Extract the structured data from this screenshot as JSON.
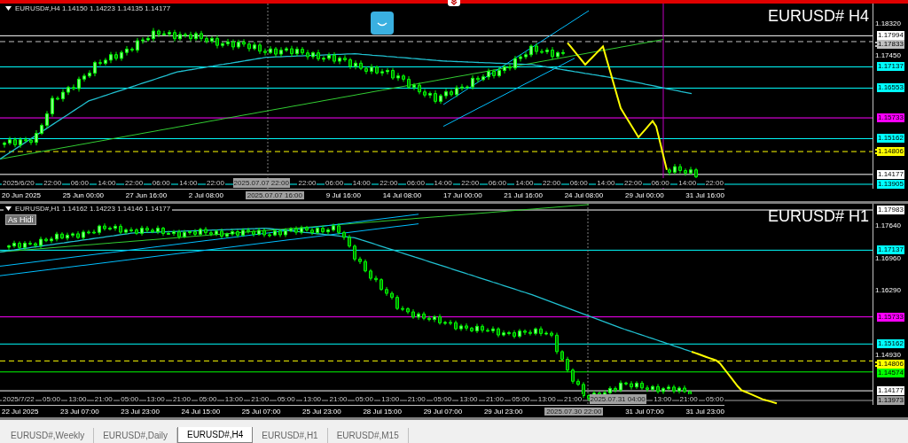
{
  "charts": [
    {
      "header": "EURUSD#,H4  1.14150 1.14223 1.14135 1.14177",
      "title": "EURUSD# H4",
      "price_labels": [
        {
          "text": "1.18320",
          "kind": "tick"
        },
        {
          "text": "1.17994",
          "kind": "marker",
          "color": "#ffffff",
          "dashed": false
        },
        {
          "text": "1.17833",
          "kind": "marker",
          "color": "#c0c0c0",
          "dashed": true
        },
        {
          "text": "1.17450",
          "kind": "tick"
        },
        {
          "text": "1.17137",
          "kind": "marker",
          "color": "#00ffff",
          "dashed": false
        },
        {
          "text": "1.16553",
          "kind": "marker",
          "color": "#00ffff",
          "dashed": false
        },
        {
          "text": "1.15733",
          "kind": "marker",
          "color": "#ff00ff",
          "dashed": false
        },
        {
          "text": "1.15162",
          "kind": "marker",
          "color": "#00ffff",
          "dashed": false
        },
        {
          "text": "1.14806",
          "kind": "marker",
          "color": "#ffff00",
          "dashed": true
        },
        {
          "text": "1.14177",
          "kind": "marker",
          "color": "#ffffff",
          "dashed": false
        },
        {
          "text": "1.13905",
          "kind": "marker",
          "color": "#00ffff",
          "dashed": false
        }
      ],
      "time_upper": [
        {
          "text": "2025/6/20",
          "kind": "time"
        },
        {
          "text": "22:00",
          "kind": "time"
        },
        {
          "text": "06:00",
          "kind": "time"
        },
        {
          "text": "14:00",
          "kind": "time"
        },
        {
          "text": "22:00",
          "kind": "time"
        },
        {
          "text": "06:00",
          "kind": "time"
        },
        {
          "text": "14:00",
          "kind": "time"
        },
        {
          "text": "22:00",
          "kind": "time"
        },
        {
          "text": "2025.07.07 22:00",
          "kind": "crosshair"
        },
        {
          "text": "22:00",
          "kind": "time"
        },
        {
          "text": "06:00",
          "kind": "time"
        },
        {
          "text": "14:00",
          "kind": "time"
        },
        {
          "text": "22:00",
          "kind": "time"
        },
        {
          "text": "06:00",
          "kind": "time"
        },
        {
          "text": "14:00",
          "kind": "time"
        },
        {
          "text": "22:00",
          "kind": "time"
        },
        {
          "text": "06:00",
          "kind": "time"
        },
        {
          "text": "14:00",
          "kind": "time"
        },
        {
          "text": "22:00",
          "kind": "time"
        },
        {
          "text": "06:00",
          "kind": "time"
        },
        {
          "text": "14:00",
          "kind": "time"
        },
        {
          "text": "22:00",
          "kind": "time"
        },
        {
          "text": "06:00",
          "kind": "time"
        },
        {
          "text": "14:00",
          "kind": "time"
        },
        {
          "text": "22:00",
          "kind": "time"
        }
      ],
      "time_lower": [
        {
          "text": "20 Jun 2025",
          "kind": "time"
        },
        {
          "text": "25 Jun 00:00",
          "kind": "time"
        },
        {
          "text": "27 Jun 16:00",
          "kind": "time"
        },
        {
          "text": "2 Jul 08:00",
          "kind": "time"
        },
        {
          "text": "2025.07.07 16:00",
          "kind": "crosshair"
        },
        {
          "text": "9 Jul 16:00",
          "kind": "time"
        },
        {
          "text": "14 Jul 08:00",
          "kind": "time"
        },
        {
          "text": "17 Jul 00:00",
          "kind": "time"
        },
        {
          "text": "21 Jul 16:00",
          "kind": "time"
        },
        {
          "text": "24 Jul 08:00",
          "kind": "time"
        },
        {
          "text": "29 Jul 00:00",
          "kind": "time"
        },
        {
          "text": "31 Jul 16:00",
          "kind": "time"
        }
      ]
    },
    {
      "header": "EURUSD#,H1  1.14162 1.14223 1.14146 1.14177",
      "title": "EURUSD# H1",
      "button": "As Hidi",
      "price_labels": [
        {
          "text": "1.17983",
          "kind": "marker",
          "color": "#ffffff",
          "dashed": false
        },
        {
          "text": "1.17640",
          "kind": "tick"
        },
        {
          "text": "1.17137",
          "kind": "marker",
          "color": "#00ffff",
          "dashed": false
        },
        {
          "text": "1.16960",
          "kind": "tick"
        },
        {
          "text": "1.16290",
          "kind": "tick"
        },
        {
          "text": "1.15733",
          "kind": "marker",
          "color": "#ff00ff",
          "dashed": false
        },
        {
          "text": "1.15162",
          "kind": "marker",
          "color": "#00ffff",
          "dashed": false
        },
        {
          "text": "1.14930",
          "kind": "tick"
        },
        {
          "text": "1.14806",
          "kind": "marker",
          "color": "#ffff00",
          "dashed": true
        },
        {
          "text": "1.14574",
          "kind": "marker",
          "color": "#00ff00",
          "dashed": false
        },
        {
          "text": "1.14177",
          "kind": "marker",
          "color": "#ffffff",
          "dashed": false
        },
        {
          "text": "1.13973",
          "kind": "marker",
          "color": "#a0a0a0",
          "dashed": false
        }
      ],
      "time_upper": [
        {
          "text": "2025/7/22",
          "kind": "time"
        },
        {
          "text": "05:00",
          "kind": "time"
        },
        {
          "text": "13:00",
          "kind": "time"
        },
        {
          "text": "21:00",
          "kind": "time"
        },
        {
          "text": "05:00",
          "kind": "time"
        },
        {
          "text": "13:00",
          "kind": "time"
        },
        {
          "text": "21:00",
          "kind": "time"
        },
        {
          "text": "05:00",
          "kind": "time"
        },
        {
          "text": "13:00",
          "kind": "time"
        },
        {
          "text": "21:00",
          "kind": "time"
        },
        {
          "text": "05:00",
          "kind": "time"
        },
        {
          "text": "13:00",
          "kind": "time"
        },
        {
          "text": "21:00",
          "kind": "time"
        },
        {
          "text": "05:00",
          "kind": "time"
        },
        {
          "text": "13:00",
          "kind": "time"
        },
        {
          "text": "21:00",
          "kind": "time"
        },
        {
          "text": "05:00",
          "kind": "time"
        },
        {
          "text": "13:00",
          "kind": "time"
        },
        {
          "text": "21:00",
          "kind": "time"
        },
        {
          "text": "05:00",
          "kind": "time"
        },
        {
          "text": "13:00",
          "kind": "time"
        },
        {
          "text": "21:00",
          "kind": "time"
        },
        {
          "text": "2025.07.31 04:00",
          "kind": "crosshair"
        },
        {
          "text": "13:00",
          "kind": "time"
        },
        {
          "text": "21:00",
          "kind": "time"
        },
        {
          "text": "05:00",
          "kind": "time"
        }
      ],
      "time_lower": [
        {
          "text": "22 Jul 2025",
          "kind": "time"
        },
        {
          "text": "23 Jul 07:00",
          "kind": "time"
        },
        {
          "text": "23 Jul 23:00",
          "kind": "time"
        },
        {
          "text": "24 Jul 15:00",
          "kind": "time"
        },
        {
          "text": "25 Jul 07:00",
          "kind": "time"
        },
        {
          "text": "25 Jul 23:00",
          "kind": "time"
        },
        {
          "text": "28 Jul 15:00",
          "kind": "time"
        },
        {
          "text": "29 Jul 07:00",
          "kind": "time"
        },
        {
          "text": "29 Jul 23:00",
          "kind": "time"
        },
        {
          "text": "2025.07.30 22:00",
          "kind": "crosshair"
        },
        {
          "text": "31 Jul 07:00",
          "kind": "time"
        },
        {
          "text": "31 Jul 23:00",
          "kind": "time"
        }
      ]
    }
  ],
  "tabs": [
    {
      "label": "EURUSD#,Weekly",
      "selected": false
    },
    {
      "label": "EURUSD#,Daily",
      "selected": false
    },
    {
      "label": "EURUSD#,H4",
      "selected": true
    },
    {
      "label": "EURUSD#,H1",
      "selected": false
    },
    {
      "label": "EURUSD#,M15",
      "selected": false
    }
  ]
}
